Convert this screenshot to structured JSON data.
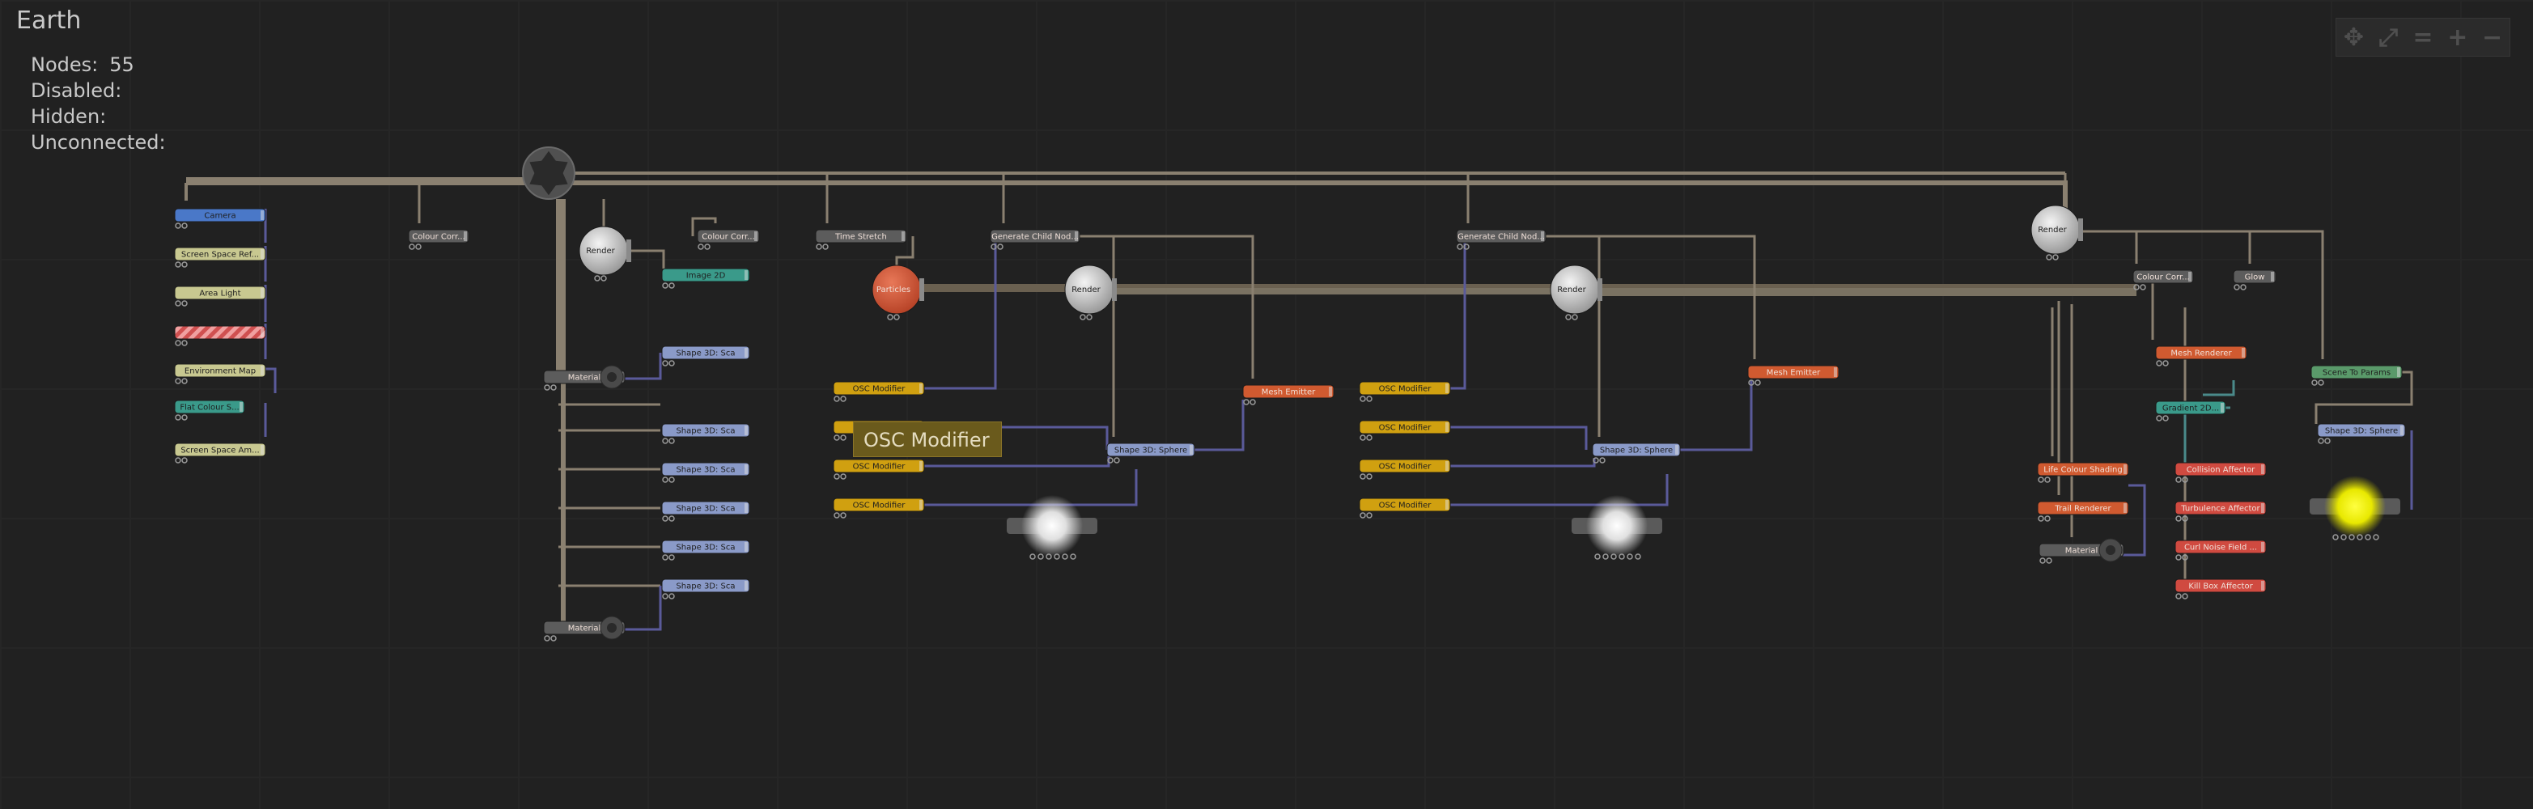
{
  "app": {
    "title": "Earth"
  },
  "stats": [
    {
      "label": "Nodes:",
      "value": "55"
    },
    {
      "label": "Disabled:",
      "value": ""
    },
    {
      "label": "Hidden:",
      "value": ""
    },
    {
      "label": "Unconnected:",
      "value": ""
    }
  ],
  "toolbar": [
    {
      "name": "move-icon",
      "glyph": "✥"
    },
    {
      "name": "fit-view-icon",
      "glyph": "⤢"
    },
    {
      "name": "reset-zoom-icon",
      "glyph": "="
    },
    {
      "name": "zoom-in-icon",
      "glyph": "+"
    },
    {
      "name": "zoom-out-icon",
      "glyph": "−"
    }
  ],
  "tooltip": "OSC  Modifier",
  "colors": {
    "camera": "#4a78c8",
    "light": "#c8c890",
    "teal": "#3a9a8a",
    "shape": "#8a9ac8",
    "osc": "#d0a010",
    "grey": "#5c5c5c",
    "emitter": "#d05a30",
    "affector": "#d04a40",
    "green": "#5a9a6a",
    "wire": "#8a8070",
    "wire_blue": "#5a5a9a"
  },
  "nodes": [
    {
      "id": "camera",
      "label": "Camera",
      "kind": "camera"
    },
    {
      "id": "ssr",
      "label": "Screen Space Ref...",
      "kind": "light"
    },
    {
      "id": "area-light",
      "label": "Area Light",
      "kind": "light"
    },
    {
      "id": "disabled-node",
      "label": "",
      "kind": "disabled"
    },
    {
      "id": "env-map",
      "label": "Environment Map",
      "kind": "light"
    },
    {
      "id": "flat-colour",
      "label": "Flat Colour S...",
      "kind": "teal"
    },
    {
      "id": "ssao",
      "label": "Screen Space Am...",
      "kind": "light"
    },
    {
      "id": "cc1",
      "label": "Colour Corr...",
      "kind": "grey"
    },
    {
      "id": "cc2",
      "label": "Colour Corr...",
      "kind": "grey"
    },
    {
      "id": "image2d",
      "label": "Image 2D",
      "kind": "teal"
    },
    {
      "id": "s3d-1",
      "label": "Shape 3D: Sca",
      "kind": "shape"
    },
    {
      "id": "s3d-2",
      "label": "Shape 3D: Sca",
      "kind": "shape"
    },
    {
      "id": "s3d-3",
      "label": "Shape 3D: Sca",
      "kind": "shape"
    },
    {
      "id": "s3d-4",
      "label": "Shape 3D: Sca",
      "kind": "shape"
    },
    {
      "id": "s3d-5",
      "label": "Shape 3D: Sca",
      "kind": "shape"
    },
    {
      "id": "s3d-6",
      "label": "Shape 3D: Sca",
      "kind": "shape"
    },
    {
      "id": "mat1",
      "label": "Material",
      "kind": "material"
    },
    {
      "id": "mat2",
      "label": "Material",
      "kind": "material"
    },
    {
      "id": "time-stretch",
      "label": "Time Stretch",
      "kind": "grey"
    },
    {
      "id": "cch1",
      "label": "Generate Child Nod...",
      "kind": "grey"
    },
    {
      "id": "osc1",
      "label": "OSC Modifier",
      "kind": "osc"
    },
    {
      "id": "osc2",
      "label": "OSC Modifier",
      "kind": "osc"
    },
    {
      "id": "osc3",
      "label": "OSC Modifier",
      "kind": "osc"
    },
    {
      "id": "osc4",
      "label": "OSC Modifier",
      "kind": "osc"
    },
    {
      "id": "sph1",
      "label": "Shape 3D: Sphere",
      "kind": "shape"
    },
    {
      "id": "mesh1",
      "label": "Mesh Emitter",
      "kind": "emitter"
    },
    {
      "id": "cch2",
      "label": "Generate Child Nod...",
      "kind": "grey"
    },
    {
      "id": "osc5",
      "label": "OSC Modifier",
      "kind": "osc"
    },
    {
      "id": "osc6",
      "label": "OSC Modifier",
      "kind": "osc"
    },
    {
      "id": "osc7",
      "label": "OSC Modifier",
      "kind": "osc"
    },
    {
      "id": "osc8",
      "label": "OSC Modifier",
      "kind": "osc"
    },
    {
      "id": "sph2",
      "label": "Shape 3D: Sphere",
      "kind": "shape"
    },
    {
      "id": "mesh2",
      "label": "Mesh Emitter",
      "kind": "emitter"
    },
    {
      "id": "cc3",
      "label": "Colour Corr...",
      "kind": "grey"
    },
    {
      "id": "glow",
      "label": "Glow",
      "kind": "grey"
    },
    {
      "id": "mesh-renderer",
      "label": "Mesh Renderer",
      "kind": "emitter"
    },
    {
      "id": "gradient",
      "label": "Gradient 2D...",
      "kind": "teal"
    },
    {
      "id": "life-colour",
      "label": "Life Colour Shading",
      "kind": "emitter"
    },
    {
      "id": "trail-renderer",
      "label": "Trail Renderer",
      "kind": "emitter"
    },
    {
      "id": "mat3",
      "label": "Material",
      "kind": "material"
    },
    {
      "id": "collision",
      "label": "Collision Affector",
      "kind": "affector"
    },
    {
      "id": "turbulence",
      "label": "Turbulence Affector",
      "kind": "affector"
    },
    {
      "id": "curl-noise",
      "label": "Curl Noise Field ...",
      "kind": "affector"
    },
    {
      "id": "kill-box",
      "label": "Kill Box Affector",
      "kind": "affector"
    },
    {
      "id": "scene-params",
      "label": "Scene To Params",
      "kind": "green"
    },
    {
      "id": "sph3",
      "label": "Shape 3D: Sphere",
      "kind": "shape"
    },
    {
      "id": "root",
      "label": "",
      "kind": "root"
    },
    {
      "id": "render1",
      "label": "Render",
      "kind": "render"
    },
    {
      "id": "render2",
      "label": "Render",
      "kind": "render"
    },
    {
      "id": "render3",
      "label": "Render",
      "kind": "render"
    },
    {
      "id": "render4",
      "label": "Render",
      "kind": "render"
    },
    {
      "id": "particles",
      "label": "Particles",
      "kind": "particles"
    },
    {
      "id": "light1",
      "label": "",
      "kind": "pointlight"
    },
    {
      "id": "light2",
      "label": "",
      "kind": "pointlight"
    },
    {
      "id": "light3",
      "label": "",
      "kind": "pointlight-yellow"
    }
  ]
}
